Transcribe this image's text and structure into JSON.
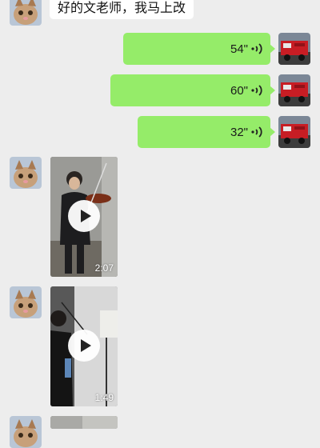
{
  "messages": [
    {
      "side": "in",
      "type": "text",
      "text": "好的文老师，我马上改"
    },
    {
      "side": "out",
      "type": "voice",
      "duration": "54\""
    },
    {
      "side": "out",
      "type": "voice",
      "duration": "60\""
    },
    {
      "side": "out",
      "type": "voice",
      "duration": "32\""
    },
    {
      "side": "in",
      "type": "video",
      "duration": "2:07"
    },
    {
      "side": "in",
      "type": "video",
      "duration": "1:49"
    },
    {
      "side": "in",
      "type": "video",
      "duration": ""
    }
  ],
  "colors": {
    "background": "#ededed",
    "outgoing_bubble": "#95ec69",
    "incoming_bubble": "#ffffff"
  },
  "icons": {
    "incoming_avatar": "cat-avatar-icon",
    "outgoing_avatar": "red-truck-avatar-icon",
    "voice": "voice-wave-icon",
    "play": "play-icon"
  }
}
